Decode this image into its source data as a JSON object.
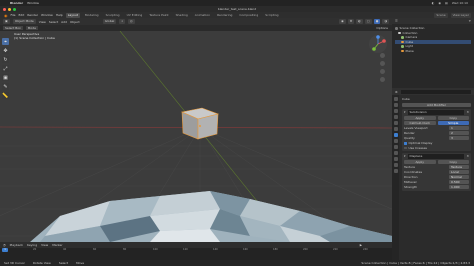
{
  "mac": {
    "app": "Blender",
    "window_menu": "Window",
    "status_items": [
      "◐",
      "◉",
      "▤",
      "Wed 10:10"
    ]
  },
  "window": {
    "title": "blender_test_scene.blend"
  },
  "top_menu": [
    "File",
    "Edit",
    "Render",
    "Window",
    "Help"
  ],
  "workspace_tabs": [
    {
      "label": "Layout",
      "active": true
    },
    {
      "label": "Modeling",
      "active": false
    },
    {
      "label": "Sculpting",
      "active": false
    },
    {
      "label": "UV Editing",
      "active": false
    },
    {
      "label": "Texture Paint",
      "active": false
    },
    {
      "label": "Shading",
      "active": false
    },
    {
      "label": "Animation",
      "active": false
    },
    {
      "label": "Rendering",
      "active": false
    },
    {
      "label": "Compositing",
      "active": false
    },
    {
      "label": "Scripting",
      "active": false
    }
  ],
  "scene_selector": {
    "scene": "Scene",
    "view_layer": "View Layer"
  },
  "viewport": {
    "mode": "Object Mode",
    "menus": [
      "View",
      "Select",
      "Add",
      "Object"
    ],
    "transform_orientation": "Global",
    "sub_items": [
      "Select Box",
      "Mode"
    ],
    "info_line1": "User Perspective",
    "info_line2": "(1) Scene Collection | Cube",
    "options_label": "Options"
  },
  "toolbar_icons": [
    "cursor-icon",
    "move-icon",
    "rotate-icon",
    "scale-icon",
    "transform-icon",
    "annotate-icon",
    "measure-icon"
  ],
  "timeline": {
    "menus": [
      "Playback",
      "Keying",
      "View",
      "Marker"
    ],
    "current_frame": "1",
    "ruler": [
      "0",
      "20",
      "40",
      "60",
      "80",
      "100",
      "120",
      "140",
      "160",
      "180",
      "200",
      "220",
      "240"
    ]
  },
  "status": {
    "left": [
      "Set 3D Cursor",
      "Rotate View",
      "Select",
      "Move"
    ],
    "right": "Scene Collection | Cube | Verts:8 | Faces:6 | Tris:12 | Objects:1/3 | 2.83.3"
  },
  "outliner": {
    "header": "Scene Collection",
    "rows": [
      {
        "label": "Scene Collection",
        "selected": false,
        "color": "#7a7a7a"
      },
      {
        "label": "Collection",
        "selected": false,
        "color": "#d0d0d0"
      },
      {
        "label": "Camera",
        "selected": false,
        "color": "#8fbf6f"
      },
      {
        "label": "Cube",
        "selected": true,
        "color": "#e89a3c"
      },
      {
        "label": "Light",
        "selected": false,
        "color": "#8fbf6f"
      },
      {
        "label": "Plane",
        "selected": false,
        "color": "#e89a3c"
      }
    ]
  },
  "properties": {
    "object_name": "Cube",
    "add_modifier": "Add Modifier",
    "modifiers": [
      {
        "name": "Subdivision",
        "buttons": [
          "Apply",
          "Copy"
        ],
        "fields": [
          {
            "label": "Catmull-Clark",
            "value": "Simple"
          },
          {
            "label": "Levels Viewport",
            "value": "1"
          },
          {
            "label": "Render",
            "value": "2"
          },
          {
            "label": "Quality",
            "value": "3"
          }
        ],
        "checks": [
          "Optimal Display",
          "Use Creases"
        ]
      },
      {
        "name": "Displace",
        "buttons": [
          "Apply",
          "Copy"
        ],
        "fields": [
          {
            "label": "Texture",
            "value": "Texture"
          },
          {
            "label": "Coordinates",
            "value": "Local"
          },
          {
            "label": "Direction",
            "value": "Normal"
          },
          {
            "label": "Midlevel",
            "value": "0.500"
          },
          {
            "label": "Strength",
            "value": "1.000"
          }
        ],
        "checks": []
      }
    ]
  },
  "colors": {
    "accent": "#3d7fd1",
    "viewport_bg": "#3c3c3c",
    "terrain_light": "#b8c4cc",
    "terrain_dark": "#546a78"
  }
}
